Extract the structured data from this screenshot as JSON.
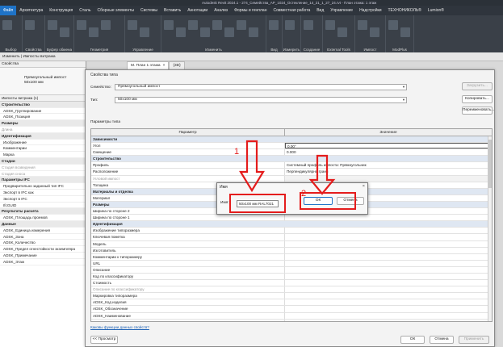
{
  "titlebar": {
    "text": "Autodesk Revit 2024.1 - 274_Семейства_AP_1024_Остекление_14_21_1_27_24.rvt - План этажа: 1 этаж"
  },
  "menu": {
    "tabs": [
      "Файл",
      "Архитектура",
      "Конструкция",
      "Сталь",
      "Сборные элементы",
      "Системы",
      "Вставить",
      "Аннотации",
      "Анализ",
      "Формы и генплан",
      "Совместная работа",
      "Вид",
      "Управление",
      "Надстройки",
      "ТЕХНОНИКОЛЬ®",
      "Lumion®"
    ]
  },
  "ribbon": {
    "groups": [
      "Выбор",
      "Свойства",
      "Буфер обмена",
      "Геометрия",
      "Управление",
      "Изменить",
      "Вид",
      "Измерить",
      "Создание",
      "External Tools",
      "Импост",
      "ModPlus"
    ]
  },
  "breadcrumb": "Изменить | Импосты витража",
  "left_panel": {
    "header": "Свойства",
    "type_name": "Прямоугольный импост",
    "type_size": "50x100 мм",
    "filter": "Импосты витража (1)",
    "rows": [
      {
        "text": "Строительство",
        "kind": "cat"
      },
      {
        "text": "ADSK_Группирование",
        "kind": "sub"
      },
      {
        "text": "ADSK_Позиция",
        "kind": "sub"
      },
      {
        "text": "Размеры",
        "kind": "cat"
      },
      {
        "text": "Длина",
        "kind": "dim"
      },
      {
        "text": "Идентификация",
        "kind": "cat"
      },
      {
        "text": "Изображение",
        "kind": "sub"
      },
      {
        "text": "Комментарии",
        "kind": "sub"
      },
      {
        "text": "Марка",
        "kind": "sub"
      },
      {
        "text": "Стадии",
        "kind": "cat"
      },
      {
        "text": "Стадия возведения",
        "kind": "dim"
      },
      {
        "text": "Стадия сноса",
        "kind": "dim"
      },
      {
        "text": "Параметры IFC",
        "kind": "cat"
      },
      {
        "text": "Предварительно заданный тип IFC",
        "kind": "sub"
      },
      {
        "text": "Экспорт в IFC как",
        "kind": "sub"
      },
      {
        "text": "Экспорт в IFC",
        "kind": "sub"
      },
      {
        "text": "IfcGUID",
        "kind": "sub"
      },
      {
        "text": "Результаты расчета",
        "kind": "cat"
      },
      {
        "text": "ADSK_Площадь проемов",
        "kind": "sub"
      },
      {
        "text": "Данные",
        "kind": "cat"
      },
      {
        "text": "ADSK_Единица измерения",
        "kind": "sub"
      },
      {
        "text": "ADSK_Зона",
        "kind": "sub"
      },
      {
        "text": "ADSK_Количество",
        "kind": "sub"
      },
      {
        "text": "ADSK_Предел огнестойкости экземпляра",
        "kind": "sub"
      },
      {
        "text": "ADSK_Примечание",
        "kind": "sub"
      },
      {
        "text": "ADSK_Этаж",
        "kind": "sub"
      }
    ]
  },
  "view_tabs": [
    {
      "label": "М. План 1 этажа",
      "close": "×"
    },
    {
      "label": "{3D}",
      "close": ""
    }
  ],
  "type_dialog": {
    "title": "Свойства типа",
    "family_label": "Семейство:",
    "family_value": "Прямоугольный импост",
    "type_label": "Тип:",
    "type_value": "50x100 мм",
    "load_button": "Загрузить...",
    "copy_button": "Копировать...",
    "rename_button": "Переименовать...",
    "params_label": "Параметры типа",
    "col_param": "Параметр",
    "col_value": "Значение",
    "rows": [
      {
        "p": "Зависимости",
        "v": "",
        "kind": "cat"
      },
      {
        "p": "Угол",
        "v": "0.00°",
        "kind": "row",
        "box": true
      },
      {
        "p": "Смещение",
        "v": "0.000",
        "kind": "row"
      },
      {
        "p": "Строительство",
        "v": "",
        "kind": "cat"
      },
      {
        "p": "Профиль",
        "v": "Системный профиль импоста: Прямоугольник",
        "kind": "row"
      },
      {
        "p": "Расположение",
        "v": "Перпендикулярно грани",
        "kind": "row"
      },
      {
        "p": "Угловой импост",
        "v": "",
        "kind": "dim",
        "grey": true
      },
      {
        "p": "Толщина",
        "v": "",
        "kind": "row"
      },
      {
        "p": "Материалы и отделка",
        "v": "",
        "kind": "cat"
      },
      {
        "p": "Материал",
        "v": "",
        "kind": "row"
      },
      {
        "p": "Размеры",
        "v": "",
        "kind": "cat"
      },
      {
        "p": "Ширина по стороне 2",
        "v": "",
        "kind": "row"
      },
      {
        "p": "Ширина по стороне 1",
        "v": "",
        "kind": "row"
      },
      {
        "p": "Идентификация",
        "v": "",
        "kind": "cat"
      },
      {
        "p": "Изображение типоразмера",
        "v": "",
        "kind": "row"
      },
      {
        "p": "Ключевая пометка",
        "v": "",
        "kind": "row"
      },
      {
        "p": "Модель",
        "v": "",
        "kind": "row"
      },
      {
        "p": "Изготовитель",
        "v": "",
        "kind": "row"
      },
      {
        "p": "Комментарии к типоразмеру",
        "v": "",
        "kind": "row"
      },
      {
        "p": "URL",
        "v": "",
        "kind": "row"
      },
      {
        "p": "Описание",
        "v": "",
        "kind": "row"
      },
      {
        "p": "Код по классификатору",
        "v": "",
        "kind": "row"
      },
      {
        "p": "Стоимость",
        "v": "",
        "kind": "row"
      },
      {
        "p": "Описание по классификатору",
        "v": "",
        "kind": "dim"
      },
      {
        "p": "Маркировка типоразмера",
        "v": "",
        "kind": "row"
      },
      {
        "p": "ADSK_Код изделия",
        "v": "",
        "kind": "row"
      },
      {
        "p": "ADSK_Обозначение",
        "v": "",
        "kind": "row"
      },
      {
        "p": "ADSK_Наименование",
        "v": "",
        "kind": "row"
      },
      {
        "p": "ADSK_Марка",
        "v": "",
        "kind": "row"
      }
    ],
    "help_link": "Каковы функции данных свойств?",
    "preview_button": "<< Просмотр",
    "ok_button": "ОК",
    "cancel_button": "Отмена",
    "apply_button": "Применить"
  },
  "name_dialog": {
    "title": "Имя",
    "close": "×",
    "name_label": "Имя:",
    "name_value": "50x100 мм RAL7021",
    "ok_button": "ОК",
    "cancel_button": "Отмена"
  },
  "annotations": {
    "color": "#e41c1c",
    "label_1": "1",
    "label_2": "2"
  }
}
